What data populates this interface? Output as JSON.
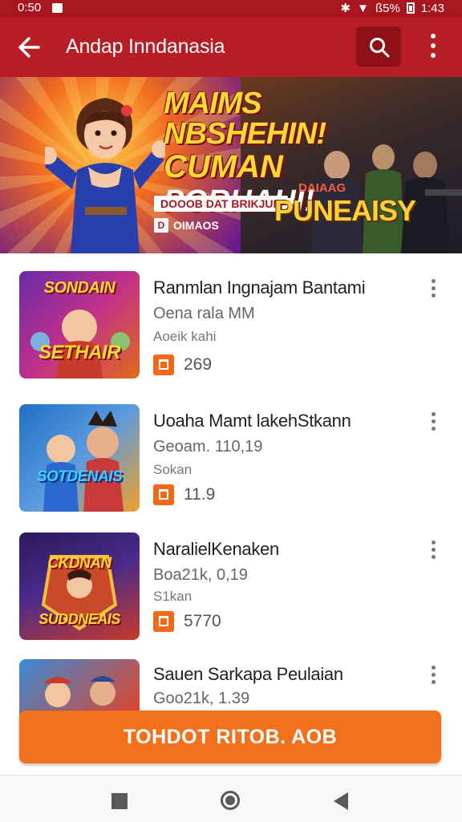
{
  "status_bar": {
    "time_left": "0:50",
    "time_right": "1:43",
    "battery": "ß5%"
  },
  "app_bar": {
    "title": "Andap Inndanasia"
  },
  "banner": {
    "headline_1": "MAIMS NBSHEHIN!",
    "headline_2": "CUMAN",
    "headline_3": "PORHAHI!",
    "tag": "DOOOB DAT BRIKJUN",
    "badge_label": "OIMAOS",
    "logo_small": "DAIAAG",
    "logo": "PUNEAISY"
  },
  "games": [
    {
      "title": "Ranmlan Ingnajam Bantami",
      "subtitle": "Oena rala MM",
      "meta": "Aoeik kahi",
      "rating": "269",
      "thumb_top": "SONDAIN",
      "thumb_bottom": "SETHAIR",
      "thumb_colors": [
        "#6a2aa8",
        "#e06a1a"
      ]
    },
    {
      "title": "Uoaha Mamt lakehStkann",
      "subtitle": "Geoam. 110,19",
      "meta": "Sokan",
      "rating": "11.9",
      "thumb_top": "",
      "thumb_bottom": "SOTDENAIS",
      "thumb_colors": [
        "#1f6fc4",
        "#f2a02a"
      ]
    },
    {
      "title": "NaralielKenaken",
      "subtitle": "Boa21k, 0,19",
      "meta": "S1kan",
      "rating": "5770",
      "thumb_top": "CKDNAN",
      "thumb_bottom": "SUDDNEAIS",
      "thumb_colors": [
        "#2a1a5a",
        "#c73a2a"
      ]
    },
    {
      "title": "Sauen Sarkapa Peulaian",
      "subtitle": "Goo21k, 1.39",
      "meta": "",
      "rating": "",
      "thumb_top": "",
      "thumb_bottom": "",
      "thumb_colors": [
        "#3a8ad6",
        "#e2442a"
      ]
    }
  ],
  "cta": {
    "label": "TOHDOT RITOB. AOB"
  },
  "colors": {
    "brand_red": "#b81c24",
    "accent_orange": "#f3711c"
  }
}
